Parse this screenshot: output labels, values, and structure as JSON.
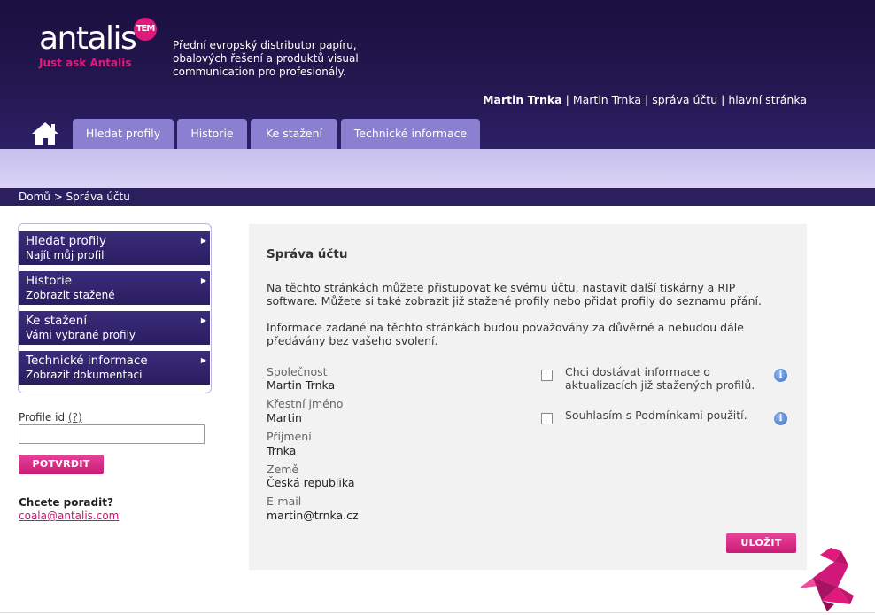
{
  "header": {
    "logo_word": "antalis",
    "logo_tm": "TEM",
    "logo_tagline": "Just ask Antalis",
    "tagline": "Přední evropský distributor papíru, obalových řešení a produktů visual communication pro profesionály.",
    "user_bold": "Martin Trnka",
    "user_name": "Martin Trnka",
    "account_link": "správa účtu",
    "home_link": "hlavní stránka",
    "separator": "|"
  },
  "nav": {
    "home_icon": "home-icon",
    "tabs": [
      {
        "label": "Hledat profily"
      },
      {
        "label": "Historie"
      },
      {
        "label": "Ke stažení"
      },
      {
        "label": "Technické informace"
      }
    ]
  },
  "breadcrumb": "Domů > Správa účtu",
  "sidebar": {
    "items": [
      {
        "title": "Hledat profily",
        "subtitle": "Najít můj profil"
      },
      {
        "title": "Historie",
        "subtitle": "Zobrazit stažené"
      },
      {
        "title": "Ke stažení",
        "subtitle": "Vámi vybrané profily"
      },
      {
        "title": "Technické informace",
        "subtitle": "Zobrazit dokumentaci"
      }
    ],
    "arrow": "▶",
    "profile_id_label": "Profile id",
    "profile_id_help": "(?)",
    "profile_id_value": "",
    "confirm_button": "POTVRDIT",
    "help_title": "Chcete poradit?",
    "help_email": "coala@antalis.com"
  },
  "main": {
    "title": "Správa účtu",
    "intro": "Na těchto stránkách můžete přistupovat ke svému účtu, nastavit další tiskárny a RIP software. Můžete si také zobrazit již stažené profily nebo přidat profily do seznamu přání.",
    "privacy": "Informace zadané na těchto stránkách budou považovány za důvěrné a nebudou dále předávány bez vašeho svolení.",
    "fields": [
      {
        "label": "Společnost",
        "value": "Martin Trnka"
      },
      {
        "label": "Křestní jméno",
        "value": "Martin"
      },
      {
        "label": "Příjmení",
        "value": "Trnka"
      },
      {
        "label": "Země",
        "value": "Česká republika"
      },
      {
        "label": "E-mail",
        "value": "martin@trnka.cz"
      }
    ],
    "checkboxes": [
      {
        "label": "Chci dostávat informace o aktualizacích již stažených profilů.",
        "checked": false
      },
      {
        "label": "Souhlasím s Podmínkami použití.",
        "checked": false
      }
    ],
    "info_glyph": "i",
    "save_button": "ULOŽIT"
  },
  "colors": {
    "header_bg": "#241852",
    "tab_bg": "#8a7fd0",
    "accent_pink": "#e0197d",
    "menu_bg": "#2f2268"
  }
}
